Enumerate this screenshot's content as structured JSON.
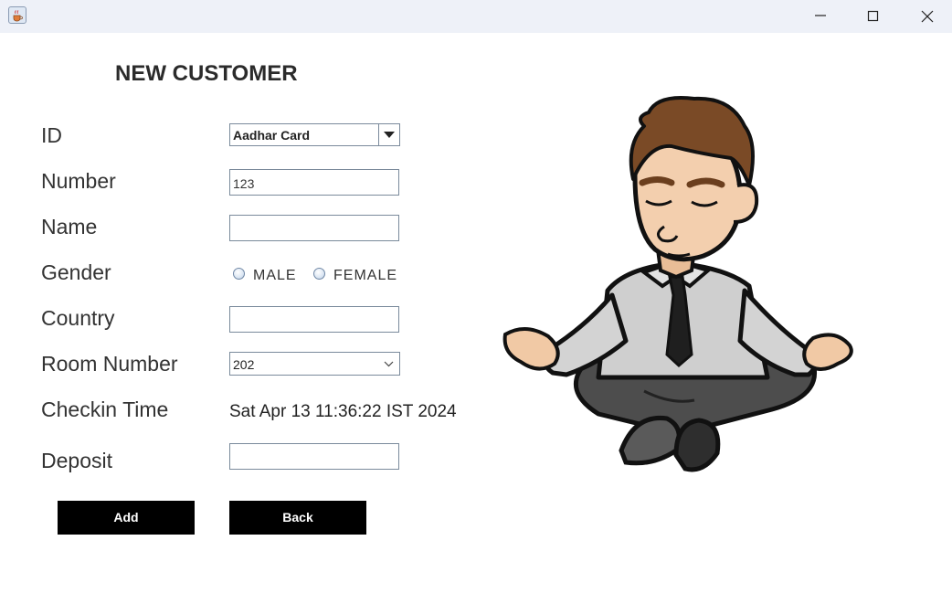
{
  "window": {
    "icon": "java-cup-icon",
    "controls": [
      "minimize-icon",
      "maximize-icon",
      "close-icon"
    ]
  },
  "form": {
    "heading": "NEW CUSTOMER",
    "labels": {
      "id": "ID",
      "number": "Number",
      "name": "Name",
      "gender": "Gender",
      "country": "Country",
      "room_number": "Room Number",
      "checkin_time": "Checkin Time",
      "deposit": "Deposit"
    },
    "id_type": {
      "selected": "Aadhar Card"
    },
    "number_value": "123",
    "name_value": "",
    "country_value": "",
    "deposit_value": "",
    "gender_options": {
      "male": "MALE",
      "female": "FEMALE"
    },
    "room_number": {
      "selected": "202"
    },
    "checkin_time_value": "Sat Apr 13 11:36:22 IST 2024",
    "buttons": {
      "add": "Add",
      "back": "Back"
    }
  },
  "illustration": {
    "subject": "meditating-man-illustration"
  },
  "colors": {
    "button_bg": "#000000",
    "button_text": "#ffffff",
    "titlebar_bg": "#eef1f8"
  }
}
